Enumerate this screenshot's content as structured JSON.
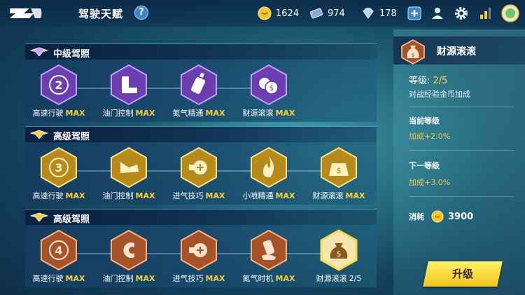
{
  "header": {
    "title": "驾驶天赋",
    "help": "?",
    "coins": "1624",
    "tickets": "974",
    "diamonds": "178"
  },
  "colors": {
    "gold": "#f6cf3a",
    "accent": "#3f86c8",
    "button": "#f4c51a"
  },
  "panels": [
    {
      "title": "中级驾照",
      "tier": "purple",
      "skills": [
        {
          "name": "高速行驶",
          "status": "MAX",
          "icon": "speedometer-2-icon"
        },
        {
          "name": "油门控制",
          "status": "MAX",
          "icon": "pedal-icon"
        },
        {
          "name": "氮气精通",
          "status": "MAX",
          "icon": "nitro-bottle-icon"
        },
        {
          "name": "财源滚滚",
          "status": "MAX",
          "icon": "coins-icon"
        }
      ]
    },
    {
      "title": "高级驾照",
      "tier": "gold",
      "skills": [
        {
          "name": "高速行驶",
          "status": "MAX",
          "icon": "speedometer-3-icon"
        },
        {
          "name": "油门控制",
          "status": "MAX",
          "icon": "pedal-icon"
        },
        {
          "name": "进气技巧",
          "status": "MAX",
          "icon": "turbo-icon"
        },
        {
          "name": "小喷精通",
          "status": "MAX",
          "icon": "flame-icon"
        },
        {
          "name": "财源滚滚",
          "status": "MAX",
          "icon": "money-scale-icon"
        }
      ]
    },
    {
      "title": "高级驾照",
      "tier": "bronze",
      "skills": [
        {
          "name": "高速行驶",
          "status": "MAX",
          "icon": "speedometer-4-icon"
        },
        {
          "name": "油门控制",
          "status": "MAX",
          "icon": "magnet-icon"
        },
        {
          "name": "进气技巧",
          "status": "MAX",
          "icon": "turbo-icon"
        },
        {
          "name": "氮气时机",
          "status": "MAX",
          "icon": "nitro-hand-icon"
        },
        {
          "name": "财源滚滚",
          "status": "2/5",
          "icon": "money-bag-icon"
        }
      ]
    }
  ],
  "detail": {
    "title": "财源滚滚",
    "level_label": "等级:",
    "level_value": "2/5",
    "desc": "对战经验金币加成",
    "current_label": "当前等级",
    "current_value": "加成+2.0%",
    "next_label": "下一等级",
    "next_value": "加成+3.0%",
    "cost_label": "消耗",
    "cost_value": "3900",
    "upgrade": "升级"
  }
}
